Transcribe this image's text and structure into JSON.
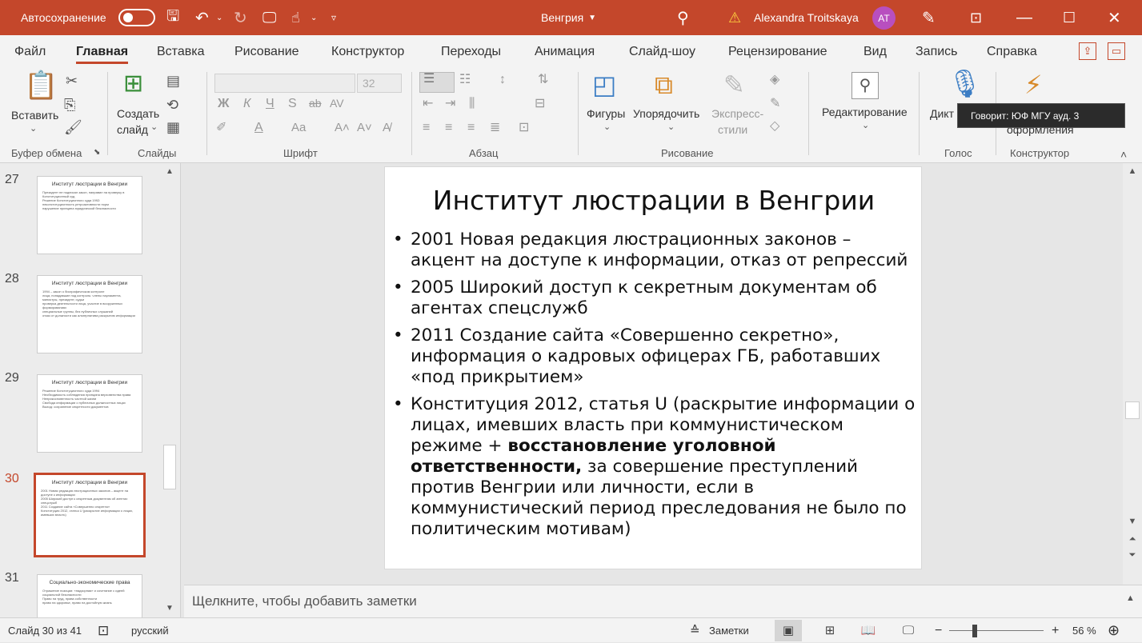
{
  "titlebar": {
    "autosave_label": "Автосохранение",
    "doc_title": "Венгрия",
    "user_name": "Alexandra Troitskaya",
    "user_initials": "AT"
  },
  "menu": {
    "tabs": [
      "Файл",
      "Главная",
      "Вставка",
      "Рисование",
      "Конструктор",
      "Переходы",
      "Анимация",
      "Слайд-шоу",
      "Рецензирование",
      "Вид",
      "Запись",
      "Справка"
    ],
    "active": "Главная"
  },
  "ribbon": {
    "clipboard": {
      "paste_label": "Вставить",
      "group_label": "Буфер обмена"
    },
    "slides": {
      "new_slide_line1": "Создать",
      "new_slide_line2": "слайд",
      "group_label": "Слайды"
    },
    "font": {
      "size_value": "32",
      "group_label": "Шрифт"
    },
    "paragraph": {
      "group_label": "Абзац"
    },
    "drawing": {
      "shapes_label": "Фигуры",
      "arrange_label": "Упорядочить",
      "styles_line1": "Экспресс-",
      "styles_line2": "стили",
      "group_label": "Рисование"
    },
    "editing": {
      "label": "Редактирование"
    },
    "voice": {
      "dictate_label": "Дикт",
      "group_label": "Голос"
    },
    "designer": {
      "ideas_label": "оформления",
      "group_label": "Конструктор"
    }
  },
  "tooltip": {
    "text": "Говорит: ЮФ МГУ ауд. 3"
  },
  "thumbnails": [
    {
      "number": "27",
      "title": "Институт люстрации в Венгрии",
      "lines": [
        "Президент не подписал закон, направил на проверку в Конституционный суд",
        "Решение Конституционного суда 1992:",
        "неконституционность ретроактивности норм",
        "нарушение принципа юридической безопасности"
      ]
    },
    {
      "number": "28",
      "title": "Институт люстрации в Венгрии",
      "lines": [
        "1994 – закон о биографическом контроле",
        "лица, попадавшие под контроль: члены парламента, министры, президент, судьи",
        "проверка деятельности лица, участие в вооруженных формированиях",
        "специальные группы, без публичных слушаний",
        "отказ от должности как альтернатива раскрытию информации"
      ]
    },
    {
      "number": "29",
      "title": "Институт люстрации в Венгрии",
      "lines": [
        "Решение Конституционного суда 1994",
        "Необходимость соблюдения принципа верховенства права",
        "Неприкосновенность частной жизни",
        "Свобода информации о публичных должностных лицах",
        "Выход: сохранение секретности документов"
      ]
    },
    {
      "number": "30",
      "title": "Институт люстрации в Венгрии",
      "lines": [
        "2001 Новая редакция люстрационных законов – акцент на доступе к информации",
        "2005 Широкий доступ к секретным документам об агентах спецслужб",
        "2011 Создание сайта «Совершенно секретно»",
        "Конституция 2012, статья U (раскрытие информации о лицах, имевших власть)"
      ]
    },
    {
      "number": "31",
      "title": "Социально-экономические права",
      "lines": [
        "Отражение позиции: «надзорная» и сочетание с идеей социальной безопасности",
        "Право на труд, права собственности",
        "право на здоровье, право на достойную жизнь"
      ]
    }
  ],
  "slide": {
    "title": "Институт люстрации в Венгрии",
    "bullet1": "2001 Новая редакция люстрационных законов – акцент на доступе к информации, отказ от репрессий",
    "bullet2": "2005 Широкий доступ к секретным документам об агентах спецслужб",
    "bullet3": "2011 Создание сайта «Совершенно секретно», информация о кадровых офицерах ГБ, работавших «под прикрытием»",
    "bullet4_part1": "Конституция 2012, статья U (раскрытие информации о лицах, имевших власть при коммунистическом режиме + ",
    "bullet4_bold": "восстановление уголовной ответственности,",
    "bullet4_part2": " за совершение преступлений против Венгрии или личности, если в коммунистический период преследования не было по политическим мотивам)"
  },
  "notes": {
    "placeholder": "Щелкните, чтобы добавить заметки"
  },
  "statusbar": {
    "slide_count": "Слайд 30 из 41",
    "language": "русский",
    "notes_label": "Заметки",
    "zoom": "56 %",
    "zoom_percent": 56
  },
  "colors": {
    "accent": "#c4472b",
    "avatar": "#b84fbf"
  }
}
